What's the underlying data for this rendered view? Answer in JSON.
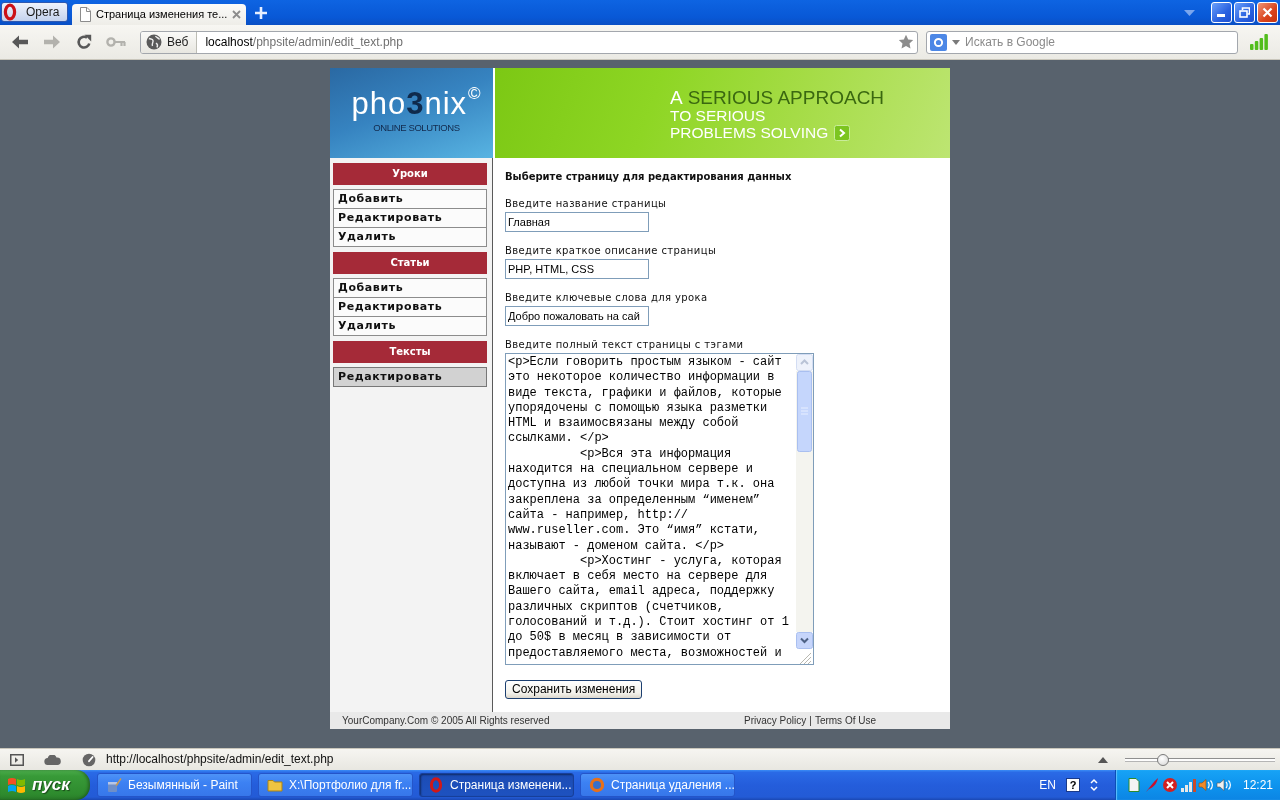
{
  "browser": {
    "menu_button": {
      "label": "Opera"
    },
    "tabs": [
      {
        "title": "Страница изменения те...",
        "selected": true
      }
    ],
    "nav_buttons": [
      {
        "kind": "back",
        "disabled": false
      },
      {
        "kind": "forward",
        "disabled": true
      },
      {
        "kind": "reload",
        "disabled": false
      },
      {
        "kind": "key",
        "disabled": true
      }
    ],
    "address_bar": {
      "badge": "Веб",
      "host": "localhost",
      "path": "/phpsite/admin/edit_text.php"
    },
    "search_field": {
      "placeholder": "Искать в Google"
    }
  },
  "page": {
    "logo": {
      "name": "pho**3**nix$^{©}$",
      "tagline": "ONLINE SOLUTIONS"
    },
    "banner": {
      "lead": "A",
      "headline": "SERIOUS APPROACH",
      "lines": [
        "TO SERIOUS",
        "PROBLEMS SOLVING"
      ]
    },
    "sidebar": {
      "sections": [
        {
          "title": "Уроки",
          "items": [
            {
              "label": "Добавить",
              "selected": false
            },
            {
              "label": "Редактировать",
              "selected": false
            },
            {
              "label": "Удалить",
              "selected": false
            }
          ]
        },
        {
          "title": "Статьи",
          "items": [
            {
              "label": "Добавить",
              "selected": false
            },
            {
              "label": "Редактировать",
              "selected": false
            },
            {
              "label": "Удалить",
              "selected": false
            }
          ]
        },
        {
          "title": "Тексты",
          "items": [
            {
              "label": "Редактировать",
              "selected": true
            }
          ]
        }
      ]
    },
    "form": {
      "heading": "Выберите страницу для редактирования данных",
      "fields": [
        {
          "kind": "input",
          "label": "Введите название страницы",
          "value": "Главная"
        },
        {
          "kind": "input",
          "label": "Введите краткое описание страницы",
          "value": "PHP, HTML, CSS"
        },
        {
          "kind": "input",
          "label": "Введите ключевые слова для урока",
          "value": "Добро пожаловать на сай"
        },
        {
          "kind": "textarea",
          "label": "Введите полный текст страницы с тэгами",
          "value": "<p>Если говорить простым языком - сайт\nэто некоторое количество информации в\nвиде текста, графики и файлов, которые\nупорядочены с помощью языка разметки\nHTML и взаимосвязаны между собой\nссылками. </p>\n          <p>Вся эта информация\nнаходится на специальном сервере и\nдоступна из любой точки мира т.к. она\nзакреплена за определенным “именем”\nсайта - например, http://\nwww.ruseller.com. Это “имя” кстати,\nназывают - доменом сайта. </p>\n          <p>Хостинг - услуга, которая\nвключает в себя место на сервере для\nВашего сайта, email адреса, поддержку\nразличных скриптов (счетчиков,\nголосований и т.д.). Стоит хостинг от 1\nдо 50$ в месяц в зависимости от\nпредоставляемого места, возможностей и"
        }
      ],
      "submit_button": "Сохранить изменения"
    },
    "footer": {
      "copyright": "YourCompany.Com © 2005 All Rights reserved",
      "links": [
        "Privacy Policy",
        "Terms Of Use"
      ],
      "separator": "|"
    }
  },
  "status_bar": {
    "url": "http://localhost/phpsite/admin/edit_text.php",
    "zoom_slider": {
      "level": 0.25
    }
  },
  "taskbar": {
    "start_button": "пуск",
    "tasks": [
      {
        "title": "Безымянный - Paint",
        "selected": false
      },
      {
        "title": "X:\\Портфолио для fr...",
        "selected": false
      },
      {
        "title": "Страница изменени...",
        "selected": true
      },
      {
        "title": "Страница удаления ...",
        "selected": false
      }
    ],
    "language": "EN",
    "help_button": "?",
    "clock": "12:21"
  }
}
